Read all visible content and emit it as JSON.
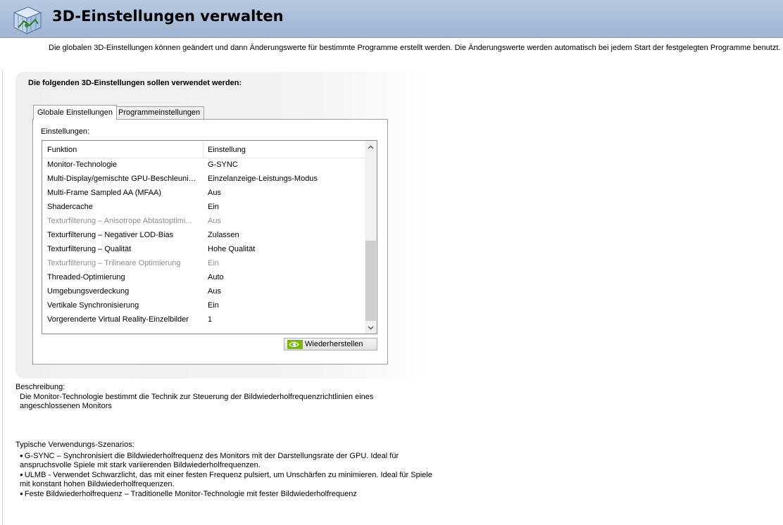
{
  "header": {
    "title": "3D-Einstellungen verwalten",
    "icon": "3d-cube-icon"
  },
  "intro_text": "Die globalen 3D-Einstellungen können geändert und dann Änderungswerte für bestimmte Programme erstellt werden. Die Änderungswerte werden automatisch bei jedem Start der festgelegten Programme benutzt.",
  "panel": {
    "heading": "Die folgenden 3D-Einstellungen sollen verwendet werden:",
    "tabs": [
      {
        "label": "Globale Einstellungen",
        "active": true
      },
      {
        "label": "Programmeinstellungen",
        "active": false
      }
    ],
    "settings_label": "Einstellungen:",
    "columns": [
      "Funktion",
      "Einstellung"
    ],
    "rows": [
      {
        "feature": "Monitor-Technologie",
        "value": "G-SYNC",
        "disabled": false
      },
      {
        "feature": "Multi-Display/gemischte GPU-Beschleunigung",
        "value": "Einzelanzeige-Leistungs-Modus",
        "disabled": false
      },
      {
        "feature": "Multi-Frame Sampled AA (MFAA)",
        "value": "Aus",
        "disabled": false
      },
      {
        "feature": "Shadercache",
        "value": "Ein",
        "disabled": false
      },
      {
        "feature": "Texturfilterung – Anisotrope Abtastoptimi...",
        "value": "Aus",
        "disabled": true
      },
      {
        "feature": "Texturfilterung – Negativer LOD-Bias",
        "value": "Zulassen",
        "disabled": false
      },
      {
        "feature": "Texturfilterung – Qualität",
        "value": "Hohe Qualität",
        "disabled": false
      },
      {
        "feature": "Texturfilterung – Trilineare Optimierung",
        "value": "Ein",
        "disabled": true
      },
      {
        "feature": "Threaded-Optimierung",
        "value": "Auto",
        "disabled": false
      },
      {
        "feature": "Umgebungsverdeckung",
        "value": "Aus",
        "disabled": false
      },
      {
        "feature": "Vertikale Synchronisierung",
        "value": "Ein",
        "disabled": false
      },
      {
        "feature": "Vorgerenderte Virtual Reality-Einzelbilder",
        "value": "1",
        "disabled": false
      }
    ],
    "restore_button": "Wiederherstellen"
  },
  "description": {
    "heading": "Beschreibung:",
    "text": "Die Monitor-Technologie bestimmt die Technik zur Steuerung der Bildwiederholfrequenzrichtlinien eines angeschlossenen Monitors"
  },
  "usage": {
    "heading": "Typische Verwendungs-Szenarios:",
    "items": [
      "G-SYNC – Synchronisiert die Bildwiederholfrequenz des Monitors mit der Darstellungsrate der GPU. Ideal für anspruchsvolle Spiele mit stark variierenden Bildwiederholfrequenzen.",
      "ULMB - Verwendet Schwarzlicht, das mit einer festen Frequenz pulsiert, um Unschärfen zu minimieren. Ideal für Spiele mit konstant hohen Bildwiederholfrequenzen.",
      "Feste Bildwiederholfrequenz – Traditionelle Monitor-Technologie mit fester Bildwiederholfrequenz"
    ]
  },
  "colors": {
    "header_bg": "#9fb5d4",
    "disabled_text": "#8e8e8e",
    "nvidia_green": "#76b900"
  }
}
